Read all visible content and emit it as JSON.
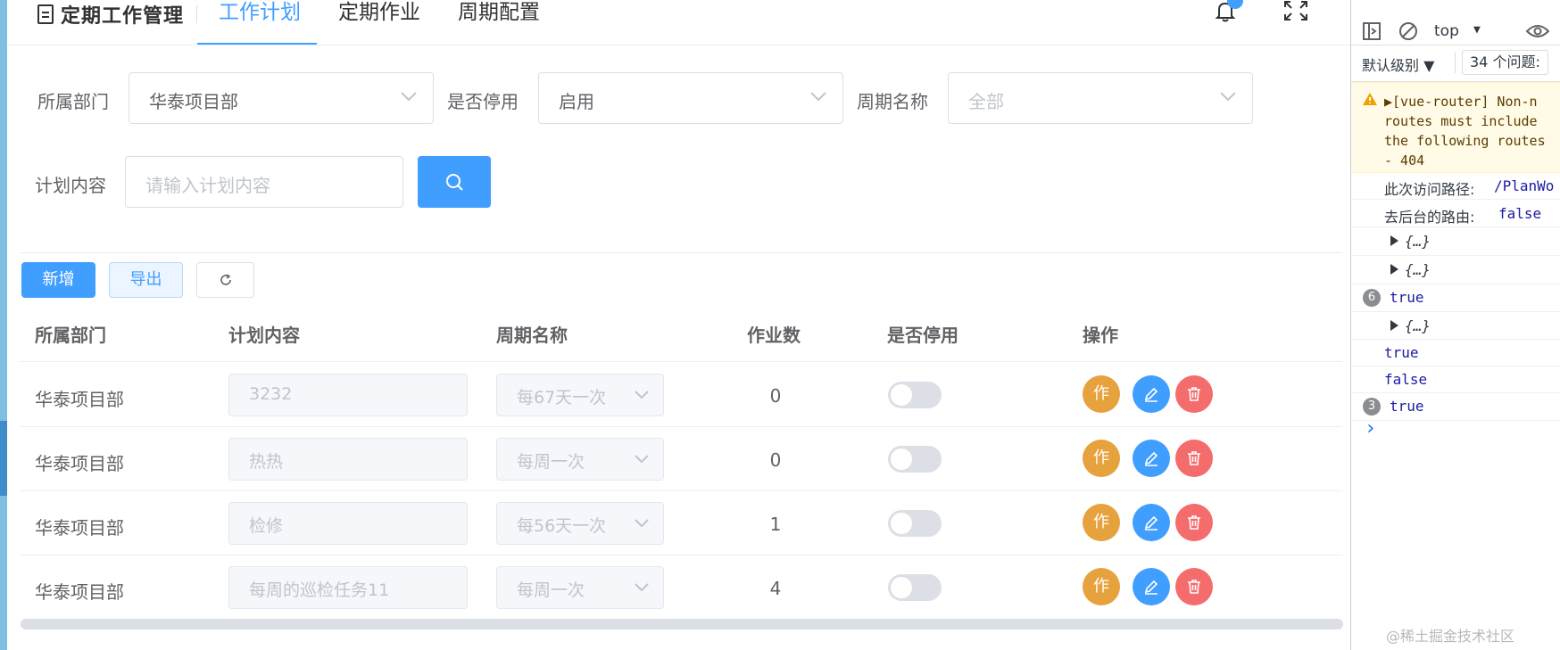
{
  "header": {
    "title": "定期工作管理",
    "tabs": [
      {
        "label": "工作计划",
        "active": true
      },
      {
        "label": "定期作业",
        "active": false
      },
      {
        "label": "周期配置",
        "active": false
      }
    ]
  },
  "filters": {
    "department_label": "所属部门",
    "department_value": "华泰项目部",
    "disabled_label": "是否停用",
    "disabled_value": "启用",
    "cycle_label": "周期名称",
    "cycle_placeholder": "全部",
    "plan_label": "计划内容",
    "plan_placeholder": "请输入计划内容"
  },
  "toolbar": {
    "add_label": "新增",
    "export_label": "导出"
  },
  "table": {
    "columns": [
      "所属部门",
      "计划内容",
      "周期名称",
      "作业数",
      "是否停用",
      "操作"
    ],
    "rows": [
      {
        "dept": "华泰项目部",
        "content": "3232",
        "cycle": "每67天一次",
        "count": "0",
        "disabled": false
      },
      {
        "dept": "华泰项目部",
        "content": "热热",
        "cycle": "每周一次",
        "count": "0",
        "disabled": false
      },
      {
        "dept": "华泰项目部",
        "content": "检修",
        "cycle": "每56天一次",
        "count": "1",
        "disabled": false
      },
      {
        "dept": "华泰项目部",
        "content": "每周的巡检任务11",
        "cycle": "每周一次",
        "count": "4",
        "disabled": false
      }
    ],
    "action_work_label": "作"
  },
  "devtools": {
    "context": "top",
    "level_label": "默认级别 ▼",
    "issues_label": "34 个问题:",
    "warning_lines": [
      "▶[vue-router] Non-n",
      "routes must include",
      "the following routes",
      "- 404"
    ],
    "log_path_label": "此次访问路径:",
    "log_path_value": "/PlanWo",
    "log_route_label": "去后台的路由:",
    "log_route_value": "false",
    "obj1": "{…}",
    "obj2": "{…}",
    "group1_count": "6",
    "group1_value": "true",
    "obj3": "{…}",
    "line_true": "true",
    "line_false": "false",
    "group2_count": "3",
    "group2_value": "true",
    "prompt": "›"
  },
  "watermark": "@稀土掘金技术社区",
  "colors": {
    "primary": "#409eff",
    "warning": "#e6a23c",
    "danger": "#f56c6c"
  }
}
